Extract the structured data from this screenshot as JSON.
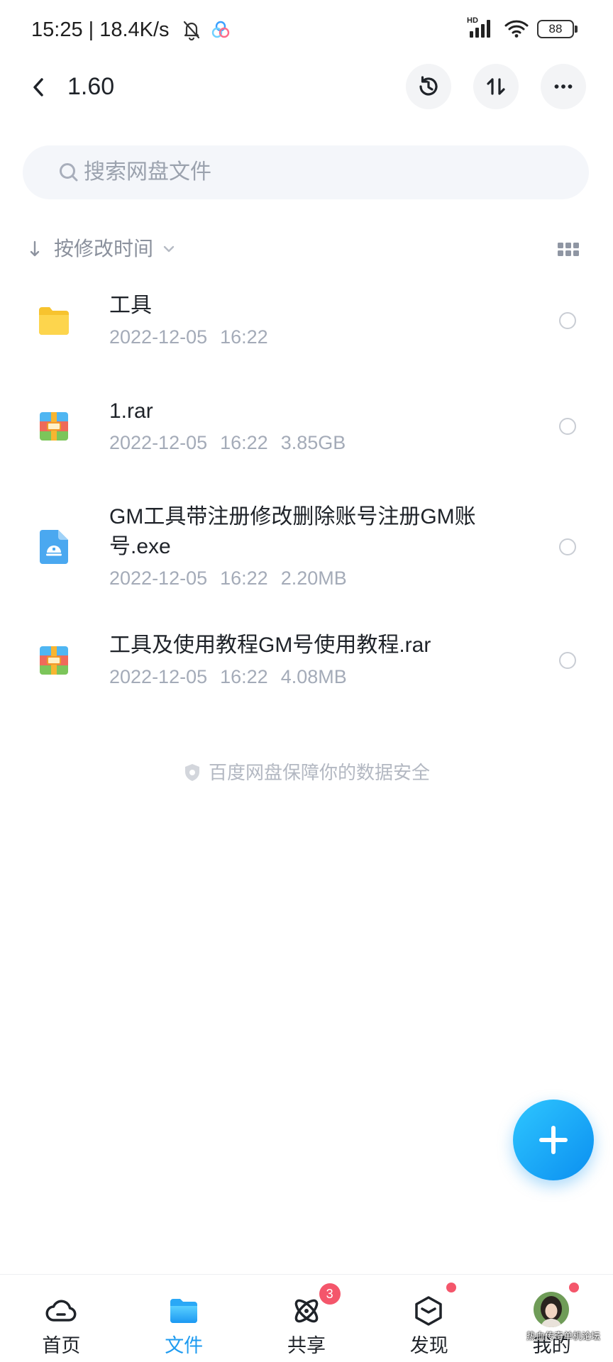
{
  "status_bar": {
    "time_speed": "15:25 | 18.4K/s",
    "network_label": "HD",
    "battery": "88",
    "icons": [
      "bell-mute-icon",
      "netdisk-app-icon",
      "signal-icon",
      "wifi-icon",
      "battery-icon"
    ]
  },
  "header": {
    "title": "1.60",
    "actions": [
      "history-icon",
      "sort-icon",
      "more-icon"
    ]
  },
  "search": {
    "placeholder": "搜索网盘文件",
    "icon": "search-icon"
  },
  "sort": {
    "label": "按修改时间",
    "view_icon": "grid-view-icon"
  },
  "files": [
    {
      "name": "工具",
      "date": "2022-12-05",
      "time": "16:22",
      "type": "folder",
      "icon": "folder-icon"
    },
    {
      "name": "1.rar",
      "date": "2022-12-05",
      "time": "16:22",
      "size": "3.85GB",
      "type": "rar",
      "icon": "rar-archive-icon"
    },
    {
      "name": "GM工具带注册修改删除账号注册GM账号.exe",
      "date": "2022-12-05",
      "time": "16:22",
      "size": "2.20MB",
      "type": "exe",
      "icon": "exe-file-icon"
    },
    {
      "name": "工具及使用教程GM号使用教程.rar",
      "date": "2022-12-05",
      "time": "16:22",
      "size": "4.08MB",
      "type": "rar",
      "icon": "rar-archive-icon"
    }
  ],
  "footer_note": "百度网盘保障你的数据安全",
  "fab": {
    "icon": "plus-icon"
  },
  "nav": {
    "items": [
      {
        "label": "首页",
        "icon": "home-cloud-icon"
      },
      {
        "label": "文件",
        "icon": "folder-icon",
        "active": true
      },
      {
        "label": "共享",
        "icon": "share-atom-icon",
        "badge": "3"
      },
      {
        "label": "发现",
        "icon": "discover-box-icon",
        "dot": true
      },
      {
        "label": "我的",
        "icon": "avatar",
        "dot": true
      }
    ]
  },
  "watermark": "热血传奇单机论坛",
  "colors": {
    "accent": "#1e9bf0",
    "badge": "#f4566b",
    "fab": "#12a4f6",
    "search_bg": "#f4f6fa",
    "secondary_text": "#a4abb8"
  }
}
